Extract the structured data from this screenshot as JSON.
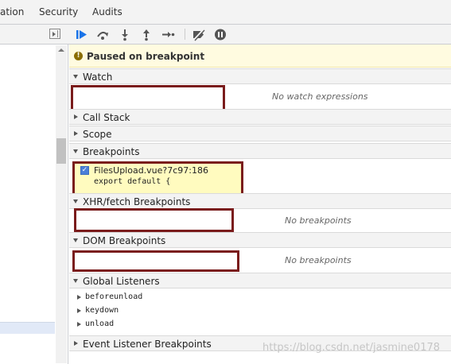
{
  "tabs": [
    "ation",
    "Security",
    "Audits"
  ],
  "paused": {
    "text": "Paused on breakpoint"
  },
  "sections": {
    "watch": "Watch",
    "call_stack": "Call Stack",
    "scope": "Scope",
    "breakpoints": "Breakpoints",
    "xhr": "XHR/fetch Breakpoints",
    "dom": "DOM Breakpoints",
    "global": "Global Listeners",
    "event": "Event Listener Breakpoints"
  },
  "watch": {
    "empty": "No watch expressions"
  },
  "breakpoint": {
    "file": "FilesUpload.vue?7c97:186",
    "code": "export default {",
    "checked": true
  },
  "xhr": {
    "empty": "No breakpoints"
  },
  "dom": {
    "empty": "No breakpoints"
  },
  "global_listeners": [
    "beforeunload",
    "keydown",
    "unload"
  ],
  "watermark": "https://blog.csdn.net/jasmine0178",
  "icons": [
    "panel-toggle-icon",
    "resume-icon",
    "step-over-icon",
    "step-into-icon",
    "step-out-icon",
    "step-icon",
    "deactivate-breakpoints-icon",
    "pause-on-exceptions-icon"
  ]
}
